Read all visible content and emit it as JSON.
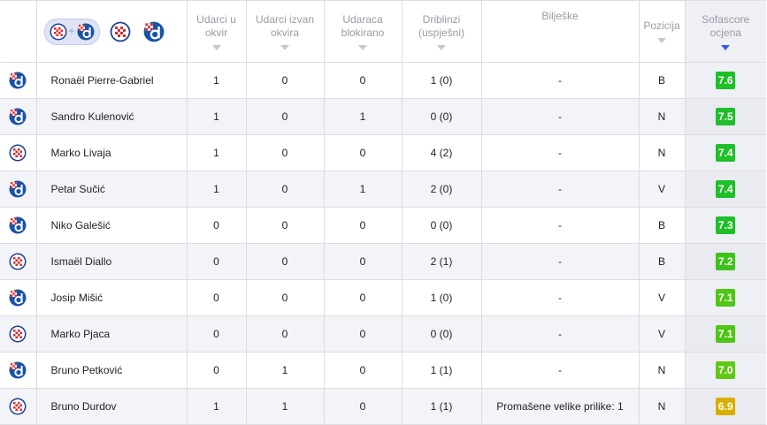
{
  "header": {
    "shots_on_target": "Udarci u okvir",
    "shots_off_target": "Udarci izvan okvira",
    "blocked_shots": "Udaraca blokirano",
    "dribbles": "Driblinzi (uspješni)",
    "notes": "Bilješke",
    "position": "Pozicija",
    "rating": "Sofascore ocjena",
    "filter_plus": "+"
  },
  "colors": {
    "rating_green_high": "#1ab548",
    "rating_green": "#1fbf28",
    "rating_lime": "#62c715",
    "rating_yellow": "#d9af00",
    "sort_active": "#3b5bdb"
  },
  "players": [
    {
      "team": "dinamo",
      "name": "Ronaël Pierre-Gabriel",
      "sot": "1",
      "soff": "0",
      "blocked": "0",
      "dribbles": "1 (0)",
      "notes": "-",
      "pos": "B",
      "rating": "7.6",
      "rating_color": "#1fbf28"
    },
    {
      "team": "dinamo",
      "name": "Sandro Kulenović",
      "sot": "1",
      "soff": "0",
      "blocked": "1",
      "dribbles": "0 (0)",
      "notes": "-",
      "pos": "N",
      "rating": "7.5",
      "rating_color": "#1fbf28"
    },
    {
      "team": "hajduk",
      "name": "Marko Livaja",
      "sot": "1",
      "soff": "0",
      "blocked": "0",
      "dribbles": "4 (2)",
      "notes": "-",
      "pos": "N",
      "rating": "7.4",
      "rating_color": "#1fbf28"
    },
    {
      "team": "dinamo",
      "name": "Petar Sučić",
      "sot": "1",
      "soff": "0",
      "blocked": "1",
      "dribbles": "2 (0)",
      "notes": "-",
      "pos": "V",
      "rating": "7.4",
      "rating_color": "#1fbf28"
    },
    {
      "team": "dinamo",
      "name": "Niko Galešić",
      "sot": "0",
      "soff": "0",
      "blocked": "0",
      "dribbles": "0 (0)",
      "notes": "-",
      "pos": "B",
      "rating": "7.3",
      "rating_color": "#1fbf28"
    },
    {
      "team": "hajduk",
      "name": "Ismaël Diallo",
      "sot": "0",
      "soff": "0",
      "blocked": "0",
      "dribbles": "2 (1)",
      "notes": "-",
      "pos": "B",
      "rating": "7.2",
      "rating_color": "#3cc31a"
    },
    {
      "team": "dinamo",
      "name": "Josip Mišić",
      "sot": "0",
      "soff": "0",
      "blocked": "0",
      "dribbles": "1 (0)",
      "notes": "-",
      "pos": "V",
      "rating": "7.1",
      "rating_color": "#4ec615"
    },
    {
      "team": "hajduk",
      "name": "Marko Pjaca",
      "sot": "0",
      "soff": "0",
      "blocked": "0",
      "dribbles": "0 (0)",
      "notes": "-",
      "pos": "V",
      "rating": "7.1",
      "rating_color": "#4ec615"
    },
    {
      "team": "dinamo",
      "name": "Bruno Petković",
      "sot": "0",
      "soff": "1",
      "blocked": "0",
      "dribbles": "1 (1)",
      "notes": "-",
      "pos": "N",
      "rating": "7.0",
      "rating_color": "#62c715"
    },
    {
      "team": "hajduk",
      "name": "Bruno Durdov",
      "sot": "1",
      "soff": "1",
      "blocked": "0",
      "dribbles": "1 (1)",
      "notes": "Promašene velike prilike: 1",
      "pos": "N",
      "rating": "6.9",
      "rating_color": "#d9af00"
    }
  ]
}
